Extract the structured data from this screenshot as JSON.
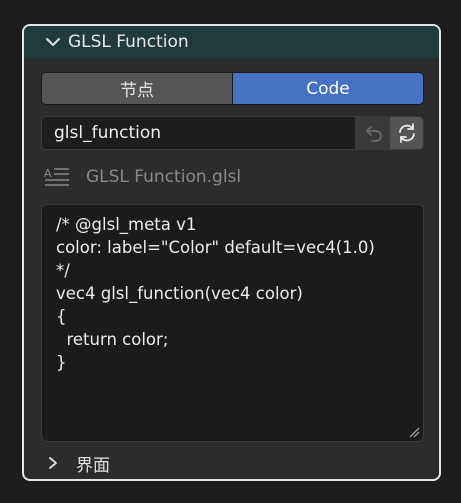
{
  "panel": {
    "title": "GLSL Function",
    "header_color": "#1f3b3b",
    "expanded_icon": "chevron-down-icon"
  },
  "tabs": [
    {
      "label": "节点",
      "active": false
    },
    {
      "label": "Code",
      "active": true
    }
  ],
  "accent_color": "#4672c4",
  "function_name": {
    "value": "glsl_function"
  },
  "actions": {
    "undo_icon": "undo-icon",
    "refresh_icon": "refresh-icon"
  },
  "file": {
    "icon": "text-file-icon",
    "name": "GLSL Function.glsl"
  },
  "code": {
    "lines": [
      "/* @glsl_meta v1",
      "color: label=\"Color\" default=vec4(1.0)",
      "*/",
      "vec4 glsl_function(vec4 color)",
      "{",
      "  return color;",
      "}"
    ]
  },
  "subpanel": {
    "label": "界面",
    "icon": "chevron-right-icon"
  }
}
